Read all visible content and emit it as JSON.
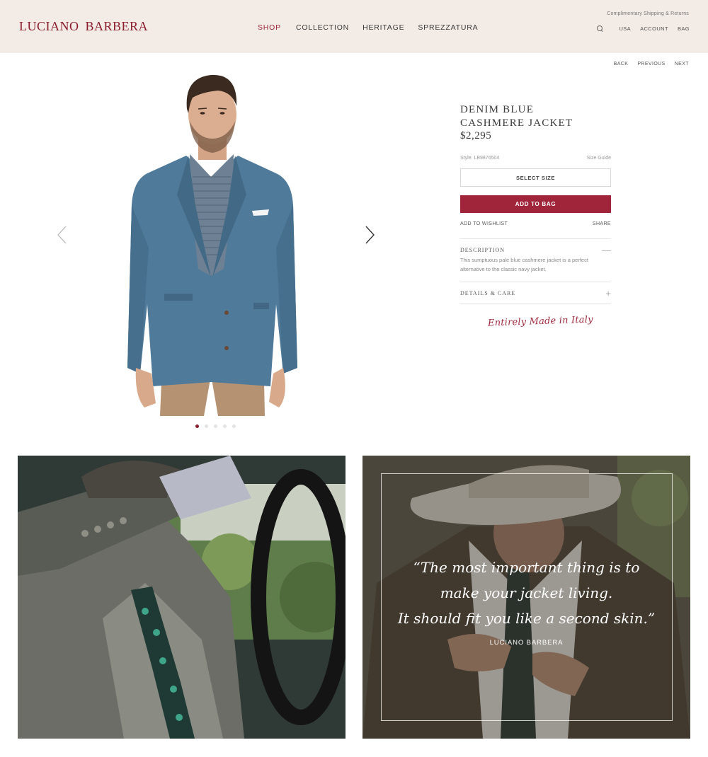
{
  "header": {
    "logo": "LUCIANO BARBERA",
    "nav": [
      "SHOP",
      "COLLECTION",
      "HERITAGE",
      "SPREZZATURA"
    ],
    "shipping": "Complimentary Shipping & Returns",
    "utility": [
      "USA",
      "ACCOUNT",
      "BAG"
    ]
  },
  "pager": [
    "BACK",
    "PREVIOUS",
    "NEXT"
  ],
  "product": {
    "name_line1": "DENIM BLUE",
    "name_line2": "CASHMERE JACKET",
    "price": "$2,295",
    "style": "Style: LB9876504",
    "size_guide": "Size Guide",
    "select_size": "SELECT SIZE",
    "add_to_bag": "ADD TO BAG",
    "add_to_wishlist": "ADD TO WISHLIST",
    "share": "SHARE",
    "description_title": "DESCRIPTION",
    "description": "This sumptuous pale blue cashmere jacket is a perfect alternative to the classic navy jacket.",
    "details_title": "DETAILS & CARE",
    "collapse_sign": "—",
    "expand_sign": "+",
    "made_in": "Entirely Made in Italy"
  },
  "carousel": {
    "count": 5,
    "active_index": 0
  },
  "lifestyle": {
    "quote_line1": "“The most important thing is to",
    "quote_line2": "make your jacket living.",
    "quote_line3": "It should fit you like a second skin.”",
    "quote_author": "LUCIANO BARBERA"
  },
  "colors": {
    "brand": "#8c1d2c",
    "button": "#a0243a",
    "header_bg": "#f2ebe6"
  }
}
